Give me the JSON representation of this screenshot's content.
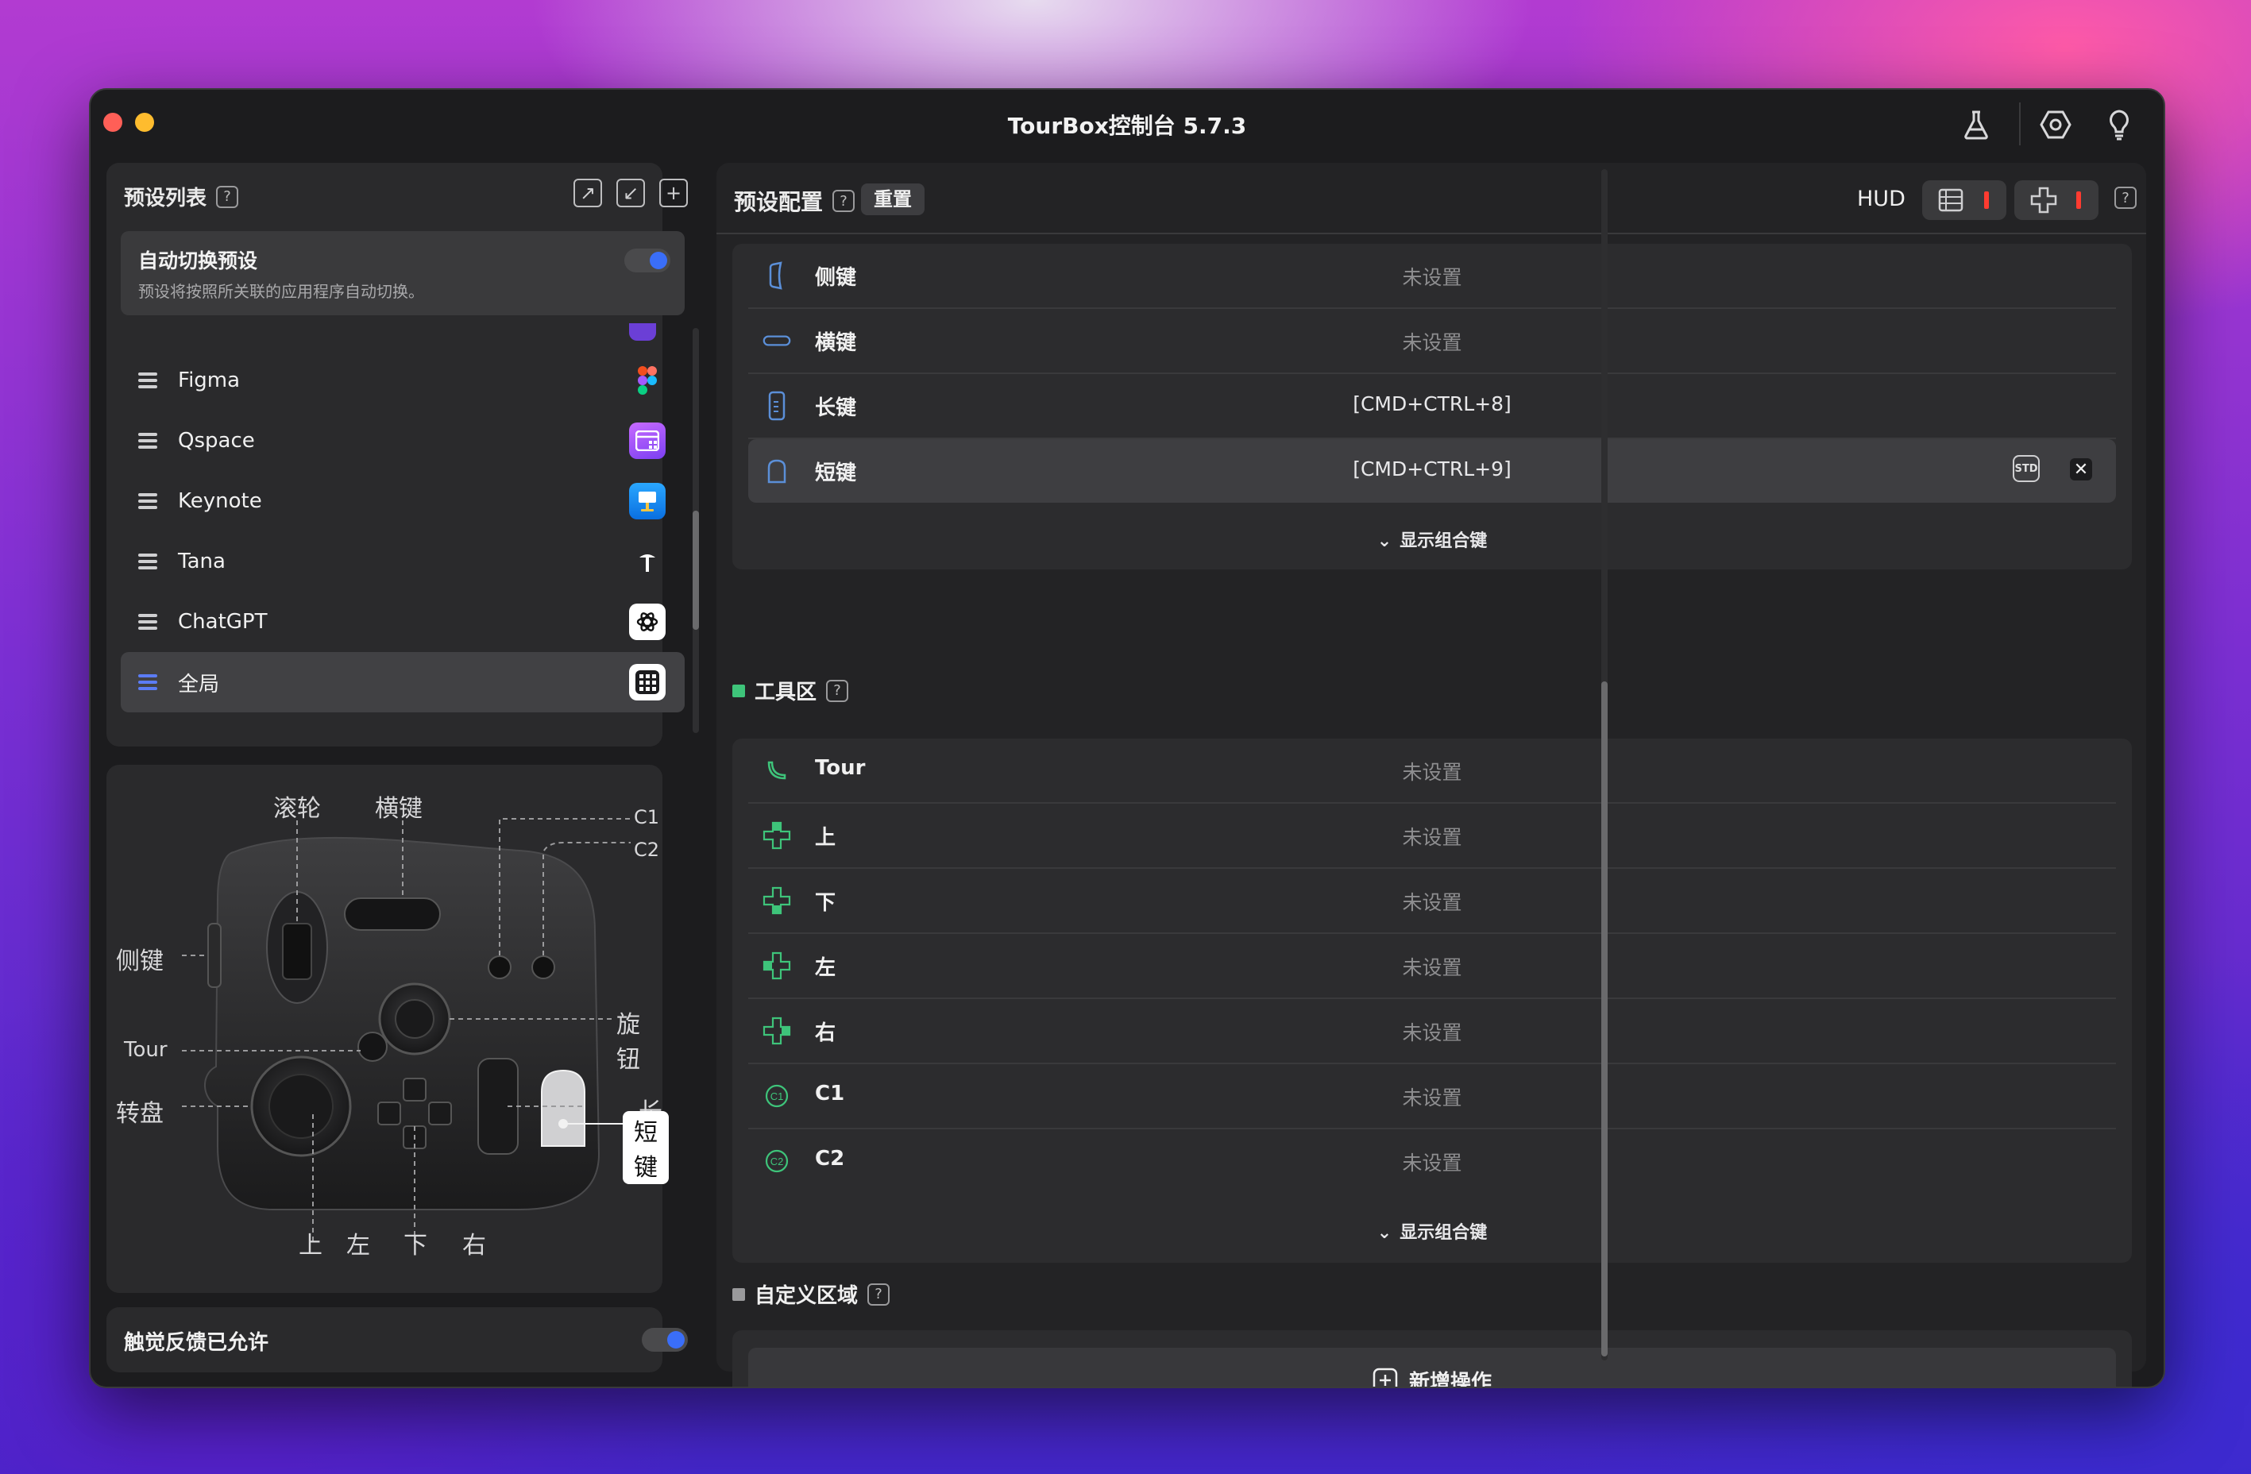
{
  "window": {
    "title": "TourBox控制台 5.7.3"
  },
  "titlebar_icons": [
    "flask-icon",
    "hexagon-settings-icon",
    "lightbulb-icon"
  ],
  "preset_list": {
    "title": "预设列表",
    "help": "?",
    "auto_switch": {
      "title": "自动切换预设",
      "desc": "预设将按照所关联的应用程序自动切换。",
      "enabled": true
    },
    "items": [
      {
        "name": "Figma",
        "icon": "figma-icon"
      },
      {
        "name": "Qspace",
        "icon": "qspace-icon"
      },
      {
        "name": "Keynote",
        "icon": "keynote-icon"
      },
      {
        "name": "Tana",
        "icon": "tana-icon"
      },
      {
        "name": "ChatGPT",
        "icon": "chatgpt-icon"
      },
      {
        "name": "全局",
        "icon": "grid-icon",
        "selected": true
      }
    ]
  },
  "device": {
    "labels": {
      "scroll": "滚轮",
      "hkey": "横键",
      "c1": "C1",
      "c2": "C2",
      "side": "侧键",
      "knob": "旋钮",
      "tour": "Tour",
      "long": "长键",
      "dial": "转盘",
      "short": "短键",
      "up": "上",
      "left": "左",
      "down": "下",
      "right": "右"
    }
  },
  "haptic": {
    "label": "触觉反馈已允许",
    "enabled": true
  },
  "config": {
    "title": "预设配置",
    "help": "?",
    "reset": "重置",
    "hud": "HUD",
    "group1": [
      {
        "name": "侧键",
        "value": "未设置",
        "icon": "side-key-icon"
      },
      {
        "name": "横键",
        "value": "未设置",
        "icon": "horizontal-key-icon"
      },
      {
        "name": "长键",
        "value": "[CMD+CTRL+8]",
        "icon": "long-key-icon"
      },
      {
        "name": "短键",
        "value": "[CMD+CTRL+9]",
        "icon": "short-key-icon",
        "selected": true
      }
    ],
    "std_label": "STD",
    "show_combo": "显示组合键",
    "tool_section": {
      "title": "工具区",
      "color": "#3ec47a"
    },
    "group2": [
      {
        "name": "Tour",
        "value": "未设置",
        "icon": "tour-icon"
      },
      {
        "name": "上",
        "value": "未设置",
        "icon": "dpad-up-icon"
      },
      {
        "name": "下",
        "value": "未设置",
        "icon": "dpad-down-icon"
      },
      {
        "name": "左",
        "value": "未设置",
        "icon": "dpad-left-icon"
      },
      {
        "name": "右",
        "value": "未设置",
        "icon": "dpad-right-icon"
      },
      {
        "name": "C1",
        "value": "未设置",
        "icon": "c1-icon"
      },
      {
        "name": "C2",
        "value": "未设置",
        "icon": "c2-icon"
      }
    ],
    "custom_section": {
      "title": "自定义区域",
      "color": "#9a9a9c"
    },
    "add_action": "新增操作"
  },
  "colors": {
    "accent": "#3a6ef8",
    "green": "#3ec47a",
    "blue_icon": "#5b8fd8",
    "red": "#ff3b30"
  }
}
